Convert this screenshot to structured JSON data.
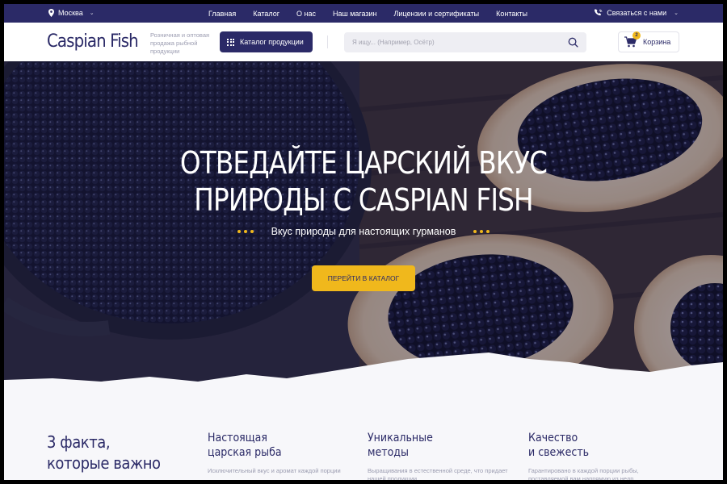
{
  "topbar": {
    "city": "Москва",
    "nav": [
      "Главная",
      "Каталог",
      "О нас",
      "Наш магазин",
      "Лицензии и сертификаты",
      "Контакты"
    ],
    "contact": "Связаться с нами",
    "bg_color": "#2b2a67"
  },
  "header": {
    "logo": "Caspian Fish",
    "tagline": "Розничная и оптовая продажа рыбной продукции",
    "catalog_button": "Каталог продукции",
    "search_placeholder": "Я ищу... (Например, Осётр)",
    "cart_label": "Корзина",
    "cart_count": "2"
  },
  "hero": {
    "title_line1": "ОТВЕДАЙТЕ ЦАРСКИЙ ВКУС",
    "title_line2": "ПРИРОДЫ С CASPIAN FISH",
    "subtitle": "Вкус природы для настоящих гурманов",
    "button": "ПЕРЕЙТИ В КАТАЛОГ",
    "accent_color": "#f0b81c"
  },
  "facts": {
    "title_line1": "3 факта,",
    "title_line2": "которые важно",
    "items": [
      {
        "title_line1": "Настоящая",
        "title_line2": "царская рыба",
        "text": "Исключительный вкус и аромат каждой порции"
      },
      {
        "title_line1": "Уникальные",
        "title_line2": "методы",
        "text": "Выращивания в естественной среде, что придает нашей продукции"
      },
      {
        "title_line1": "Качество",
        "title_line2": "и свежесть",
        "text": "Гарантировано в каждой порции рыбы, поставляемой вам напрямую из недр"
      }
    ]
  }
}
